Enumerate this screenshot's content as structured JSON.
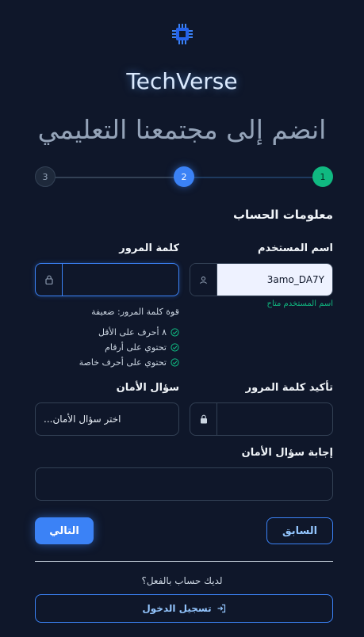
{
  "brand": {
    "name": "TechVerse",
    "logo_icon": "chip-icon"
  },
  "headline": "انضم إلى مجتمعنا التعليمي",
  "steps": {
    "items": [
      "1",
      "2",
      "3"
    ],
    "current": 2
  },
  "section_title": "معلومات الحساب",
  "username": {
    "label": "اسم المستخدم",
    "value": "3amo_DA7Y",
    "hint": "اسم المستخدم متاح",
    "icon": "user-icon"
  },
  "password": {
    "label": "كلمة المرور",
    "value": "",
    "icon": "lock-icon",
    "strength": "قوة كلمة المرور: ضعيفة"
  },
  "requirements": [
    "٨ أحرف على الأقل",
    "تحتوي على أرقام",
    "تحتوي على أحرف خاصة"
  ],
  "confirm_password": {
    "label": "تأكيد كلمة المرور",
    "value": "",
    "icon": "lock-icon"
  },
  "security_question": {
    "label": "سؤال الأمان",
    "selected": "اختر سؤال الأمان..."
  },
  "security_answer": {
    "label": "إجابة سؤال الأمان",
    "value": ""
  },
  "buttons": {
    "prev": "السابق",
    "next": "التالي"
  },
  "footer": {
    "have_account": "لديك حساب بالفعل؟",
    "login": "تسجيل الدخول"
  },
  "colors": {
    "accent": "#3b82f6",
    "success": "#10b981",
    "background": "#0f172a"
  }
}
